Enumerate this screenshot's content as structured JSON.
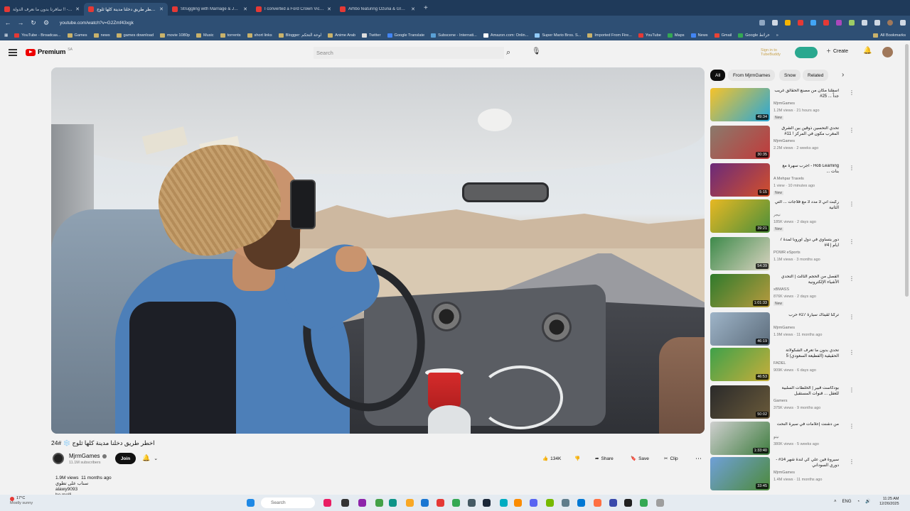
{
  "browser": {
    "tabs": [
      {
        "title": "سافرنا بدون ما نعرف الدولة !! - ..."
      },
      {
        "title": "اخطر طريق دخلنا مدينة كلها ثلوج ..."
      },
      {
        "title": "Struggling with Marriage & Job..."
      },
      {
        "title": "I converted a Ford Crown Victori..."
      },
      {
        "title": "Arhbo featuring Ozuna & GIMS..."
      }
    ],
    "new_tab": "+",
    "url": "youtube.com/watch?v=G2Zmf43xgk",
    "bookmarks": [
      "YouTube - Broadcas...",
      "Games",
      "news",
      "games download",
      "movie 1080p",
      "Music",
      "torrents",
      "short links",
      "Blogger: لوحة التحكم",
      "Anime Arab",
      "Twitter",
      "Google Translate",
      "Subscene - Internati...",
      "Amazon.com: Onlin...",
      "Super Mario Bros. S...",
      "Imported From Fire...",
      "YouTube",
      "Maps",
      "News",
      "Gmail",
      "Google خرائط"
    ],
    "all_bookmarks": "All Bookmarks"
  },
  "youtube": {
    "logo_text": "Premium",
    "logo_country": "SA",
    "search_placeholder": "Search",
    "tubebuddy_text": "Sign in to TubeBuddy",
    "create_label": "Create",
    "video": {
      "title": "اخطر طريق دخلنا مدينة كلها ثلوج ❄️ #24",
      "channel": "MjrmGames",
      "subscribers": "11.1M subscribers",
      "join_label": "Join",
      "likes": "134K",
      "share_label": "Share",
      "save_label": "Save",
      "clip_label": "Clip",
      "views": "1.9M views",
      "age": "11 months ago",
      "desc_lines": [
        "سناب على تطوي",
        "alawy9093",
        "ho melli",
        "إنستا تويوتو"
      ]
    },
    "chips": [
      "All",
      "From MjrmGames",
      "Snow",
      "Related"
    ],
    "recommendations": [
      {
        "title": "اسفلنا مكان من مصنع الحقائق غريب جداً ... 25#",
        "channel": "MjrmGames",
        "meta": "1.2M views · 21 hours ago",
        "duration": "49:34",
        "new": "New"
      },
      {
        "title": "تحدي التحسين ذوقين بين الشرق المغرب مكون في المركز ! 11#",
        "channel": "MjrmGames",
        "meta": "2.2M views · 2 weeks ago",
        "duration": "30:35",
        "new": ""
      },
      {
        "title": "Hob Learning - أجرب سهرة مع بنات ... ",
        "channel": "A Mehpar Travels",
        "meta": "1 view · 10 minutes ago",
        "duration": "5:15",
        "new": "New"
      },
      {
        "title": "ركبت اني 3 مدد 3 مع فلاجات ... التي الثانية",
        "channel": "نيجر",
        "meta": "185K views · 2 days ago",
        "duration": "39:21",
        "new": "New"
      },
      {
        "title": "دور يتساوي في دول أوروبا لمدة 7 ايام | 4#",
        "channel": "POWR eSports",
        "meta": "1.1M views · 3 months ago",
        "duration": "54:39",
        "new": ""
      },
      {
        "title": "الفصل من الحجم الثالث | التحدي الأشياء الإلكترونية",
        "channel": "xBMASS",
        "meta": "876K views · 2 days ago",
        "duration": "1:01:33",
        "new": "New"
      },
      {
        "title": "تركنا لقيناك سيارة 27# حرب",
        "channel": "MjrmGames",
        "meta": "1.9M views · 11 months ago",
        "duration": "46:19",
        "new": ""
      },
      {
        "title": "تحدي بدون ما تعرف الشكولاتة الحقيقية (الفظيعة السعودي) 5",
        "channel": "FADEL",
        "meta": "909K views · 6 days ago",
        "duration": "46:53",
        "new": ""
      },
      {
        "title": "بودكاست قبير | الخلطات السلبية للعقل ... قنوات المستقبل",
        "channel": "Gamers",
        "meta": "375K views · 9 months ago",
        "duration": "50:02",
        "new": ""
      },
      {
        "title": "من دشنت إعلامات في سيرة النحت",
        "channel": "نيتو",
        "meta": "380K views · 5 weeks ago",
        "duration": "1:33:40",
        "new": ""
      },
      {
        "title": "سيروة فين علي كي لندة شهر 14# - دوري السوداني",
        "channel": "MjrmGames",
        "meta": "1.4M views · 11 months ago",
        "duration": "33:45",
        "new": ""
      }
    ]
  },
  "taskbar": {
    "weather_temp": "17°C",
    "weather_text": "Mostly sunny",
    "search_placeholder": "Search",
    "lang": "ENG",
    "time": "11:25 AM",
    "date": "12/26/2025"
  },
  "colors": {
    "youtube_red": "#ff0000",
    "browser_chrome": "#2e4f74",
    "tab_bar": "#1f3a5a",
    "tubebuddy_green": "#2aa88f"
  }
}
